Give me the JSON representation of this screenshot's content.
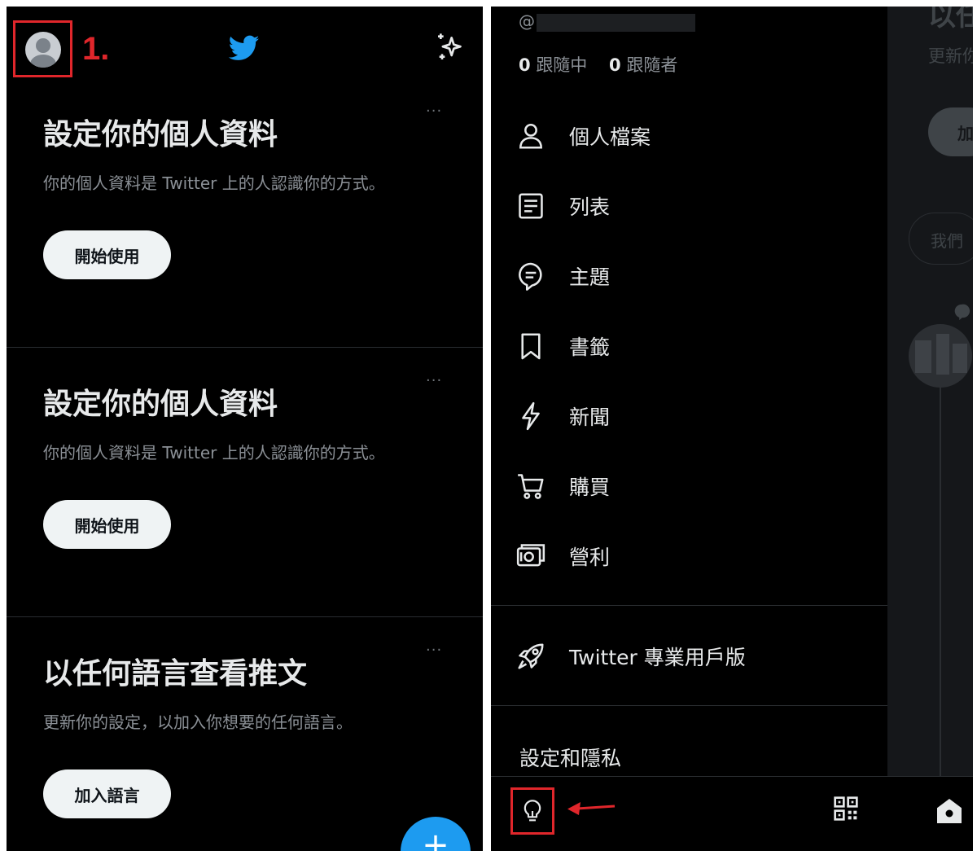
{
  "annotations": {
    "step_label": "1.",
    "highlight_color": "#e0262b"
  },
  "left": {
    "header": {
      "avatar_icon": "avatar-icon",
      "logo_icon": "twitter-bird-icon",
      "logo_color": "#1d9bf0",
      "sparkle_icon": "sparkle-icon"
    },
    "cards": [
      {
        "title": "設定你的個人資料",
        "description": "你的個人資料是 Twitter 上的人認識你的方式。",
        "button": "開始使用",
        "more": "···"
      },
      {
        "title": "設定你的個人資料",
        "description": "你的個人資料是 Twitter 上的人認識你的方式。",
        "button": "開始使用",
        "more": "···"
      },
      {
        "title": "以任何語言查看推文",
        "description": "更新你的設定，以加入你想要的任何語言。",
        "button": "加入語言",
        "more": "···"
      }
    ],
    "fab_label": "+"
  },
  "right": {
    "drawer": {
      "handle_prefix": "@",
      "following_count": "0",
      "following_label": "跟隨中",
      "followers_count": "0",
      "followers_label": "跟隨者",
      "menu": [
        {
          "label": "個人檔案",
          "icon": "person-icon"
        },
        {
          "label": "列表",
          "icon": "list-icon"
        },
        {
          "label": "主題",
          "icon": "topics-icon"
        },
        {
          "label": "書籤",
          "icon": "bookmark-icon"
        },
        {
          "label": "新聞",
          "icon": "lightning-icon"
        },
        {
          "label": "購買",
          "icon": "cart-icon"
        },
        {
          "label": "營利",
          "icon": "money-icon"
        }
      ],
      "professional": {
        "label": "Twitter 專業用戶版",
        "icon": "rocket-icon"
      },
      "settings_label": "設定和隱私",
      "bottom_icons": [
        "lightbulb-icon",
        "qr-code-icon"
      ]
    },
    "background": {
      "title_partial": "以任",
      "subtitle_partial": "更新你",
      "button_partial": "加",
      "search_partial": "我們"
    }
  }
}
